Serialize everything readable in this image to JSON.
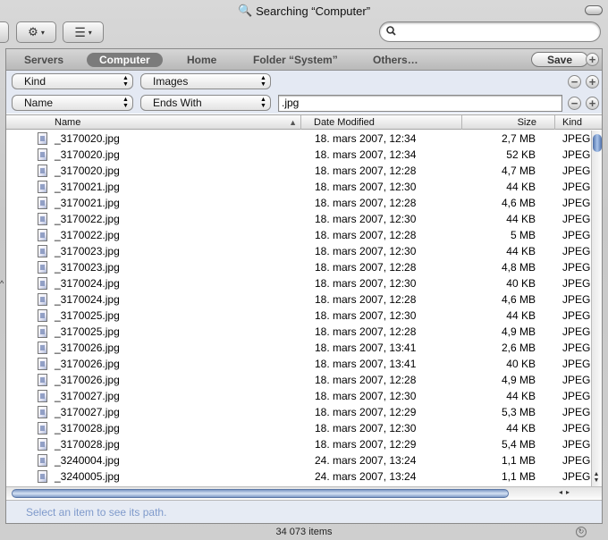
{
  "window": {
    "title": "Searching “Computer”"
  },
  "toolbar": {
    "action_icon": "gear-icon",
    "view_icon": "list-view-icon",
    "search_placeholder": ""
  },
  "scope": {
    "items": [
      "Servers",
      "Computer",
      "Home",
      "Folder “System”",
      "Others…"
    ],
    "selected": "Computer",
    "save_label": "Save"
  },
  "criteria": [
    {
      "attribute": "Kind",
      "operator": "Images",
      "value": ""
    },
    {
      "attribute": "Name",
      "operator": "Ends With",
      "value": ".jpg"
    }
  ],
  "table": {
    "columns": [
      "Name",
      "Date Modified",
      "Size",
      "Kind"
    ],
    "rows": [
      {
        "name": "_3170020.jpg",
        "date": "18. mars 2007, 12:34",
        "size": "2,7 MB",
        "kind": "JPEG"
      },
      {
        "name": "_3170020.jpg",
        "date": "18. mars 2007, 12:34",
        "size": "52 KB",
        "kind": "JPEG"
      },
      {
        "name": "_3170020.jpg",
        "date": "18. mars 2007, 12:28",
        "size": "4,7 MB",
        "kind": "JPEG"
      },
      {
        "name": "_3170021.jpg",
        "date": "18. mars 2007, 12:30",
        "size": "44 KB",
        "kind": "JPEG"
      },
      {
        "name": "_3170021.jpg",
        "date": "18. mars 2007, 12:28",
        "size": "4,6 MB",
        "kind": "JPEG"
      },
      {
        "name": "_3170022.jpg",
        "date": "18. mars 2007, 12:30",
        "size": "44 KB",
        "kind": "JPEG"
      },
      {
        "name": "_3170022.jpg",
        "date": "18. mars 2007, 12:28",
        "size": "5 MB",
        "kind": "JPEG"
      },
      {
        "name": "_3170023.jpg",
        "date": "18. mars 2007, 12:30",
        "size": "44 KB",
        "kind": "JPEG"
      },
      {
        "name": "_3170023.jpg",
        "date": "18. mars 2007, 12:28",
        "size": "4,8 MB",
        "kind": "JPEG"
      },
      {
        "name": "_3170024.jpg",
        "date": "18. mars 2007, 12:30",
        "size": "40 KB",
        "kind": "JPEG"
      },
      {
        "name": "_3170024.jpg",
        "date": "18. mars 2007, 12:28",
        "size": "4,6 MB",
        "kind": "JPEG"
      },
      {
        "name": "_3170025.jpg",
        "date": "18. mars 2007, 12:30",
        "size": "44 KB",
        "kind": "JPEG"
      },
      {
        "name": "_3170025.jpg",
        "date": "18. mars 2007, 12:28",
        "size": "4,9 MB",
        "kind": "JPEG"
      },
      {
        "name": "_3170026.jpg",
        "date": "18. mars 2007, 13:41",
        "size": "2,6 MB",
        "kind": "JPEG"
      },
      {
        "name": "_3170026.jpg",
        "date": "18. mars 2007, 13:41",
        "size": "40 KB",
        "kind": "JPEG"
      },
      {
        "name": "_3170026.jpg",
        "date": "18. mars 2007, 12:28",
        "size": "4,9 MB",
        "kind": "JPEG"
      },
      {
        "name": "_3170027.jpg",
        "date": "18. mars 2007, 12:30",
        "size": "44 KB",
        "kind": "JPEG"
      },
      {
        "name": "_3170027.jpg",
        "date": "18. mars 2007, 12:29",
        "size": "5,3 MB",
        "kind": "JPEG"
      },
      {
        "name": "_3170028.jpg",
        "date": "18. mars 2007, 12:30",
        "size": "44 KB",
        "kind": "JPEG"
      },
      {
        "name": "_3170028.jpg",
        "date": "18. mars 2007, 12:29",
        "size": "5,4 MB",
        "kind": "JPEG"
      },
      {
        "name": "_3240004.jpg",
        "date": "24. mars 2007, 13:24",
        "size": "1,1 MB",
        "kind": "JPEG"
      },
      {
        "name": "_3240005.jpg",
        "date": "24. mars 2007, 13:24",
        "size": "1,1 MB",
        "kind": "JPEG"
      }
    ]
  },
  "path_bar": {
    "text": "Select an item to see its path."
  },
  "status": {
    "item_count": "34 073 items"
  },
  "colors": {
    "selected_scope": "#7b7b7b",
    "criteria_bg": "#e4e9f3",
    "path_text": "#7f9acb"
  }
}
